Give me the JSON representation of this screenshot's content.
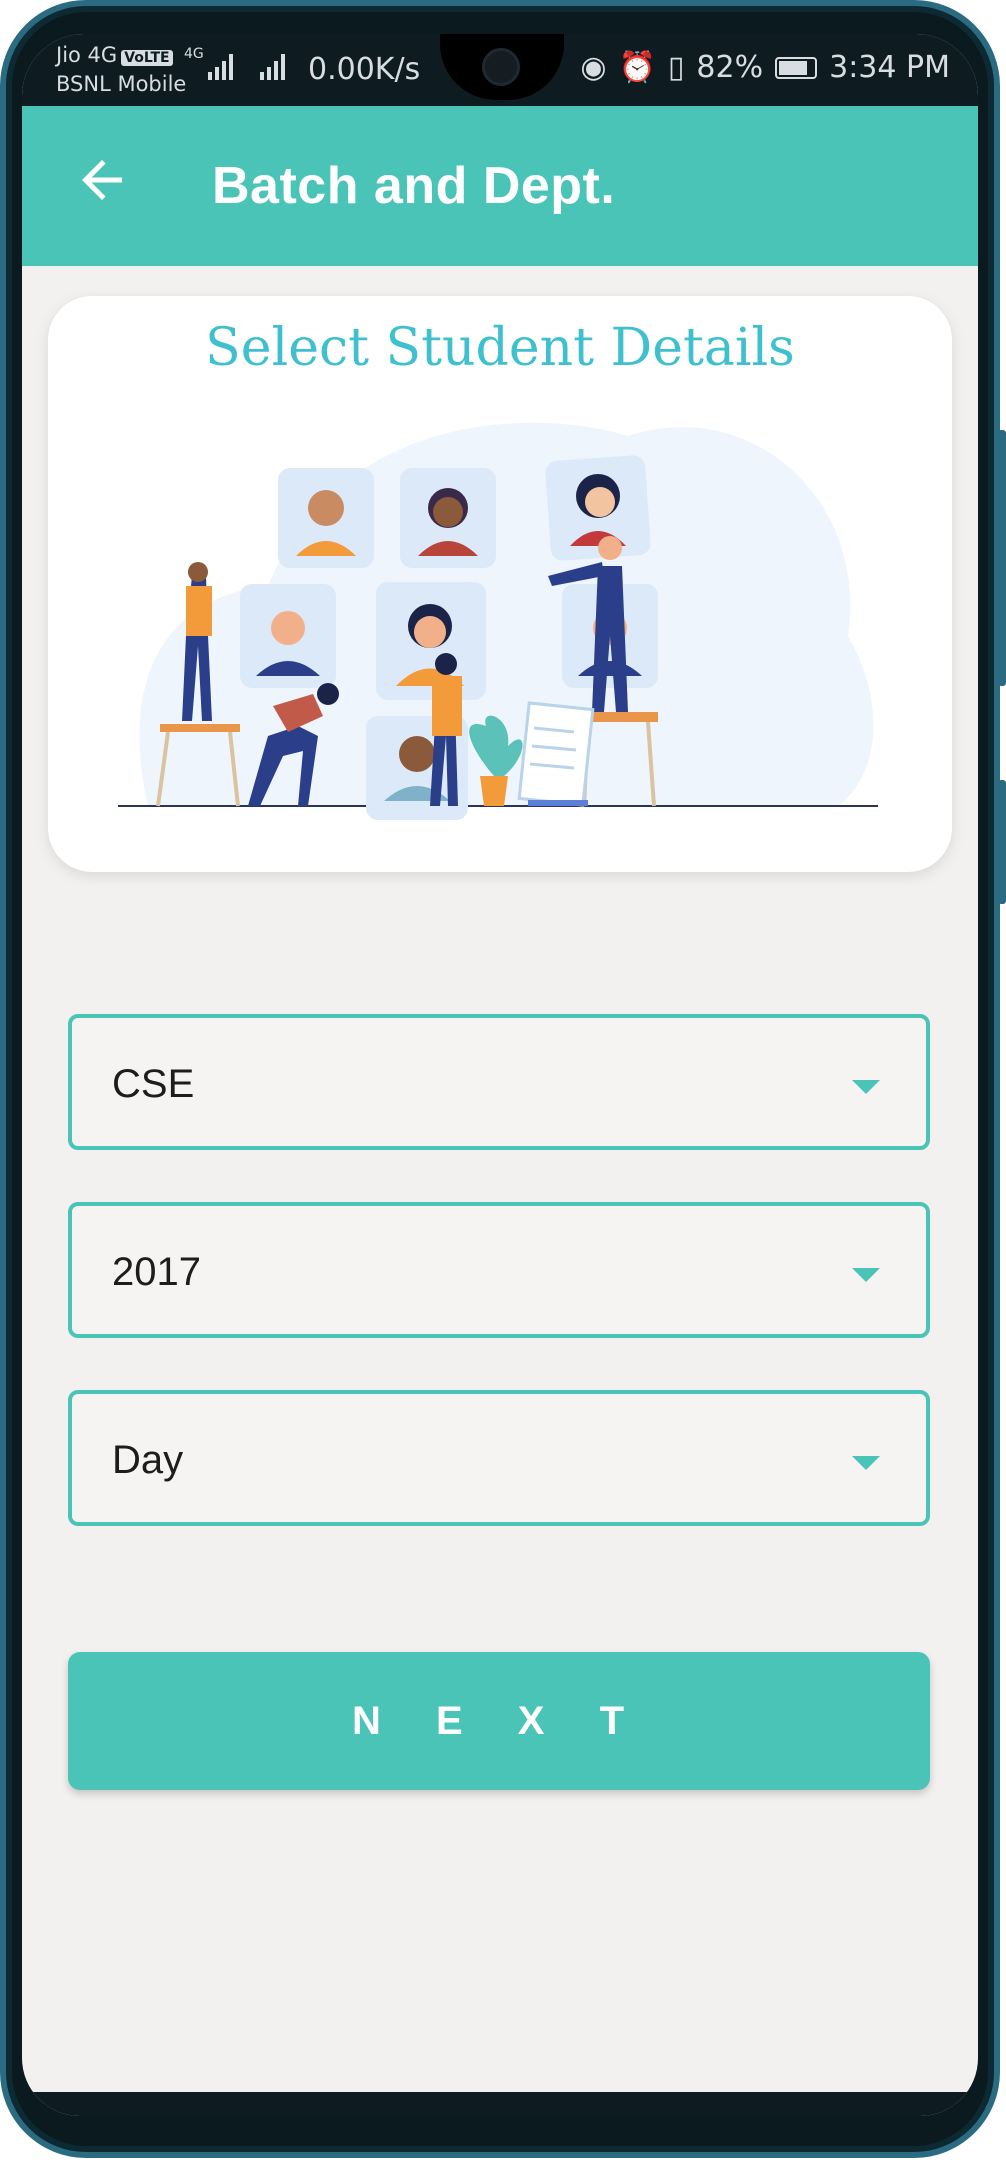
{
  "status_bar": {
    "carrier_1": "Jio 4G",
    "volte_badge": "VoLTE",
    "carrier_2": "BSNL Mobile",
    "network_type": "4G",
    "net_speed": "0.00K/s",
    "battery_percent": "82%",
    "time": "3:34 PM"
  },
  "app_bar": {
    "title": "Batch and Dept.",
    "back_icon": "arrow-back-icon"
  },
  "hero": {
    "title": "Select Student Details"
  },
  "form": {
    "department_value": "CSE",
    "batch_year_value": "2017",
    "shift_value": "Day"
  },
  "actions": {
    "next_label": "N E X T"
  },
  "colors": {
    "accent": "#4ac4b7",
    "hero_title": "#3fc0ce",
    "background": "#f3f1ef",
    "status_bar": "#0e1c22"
  }
}
